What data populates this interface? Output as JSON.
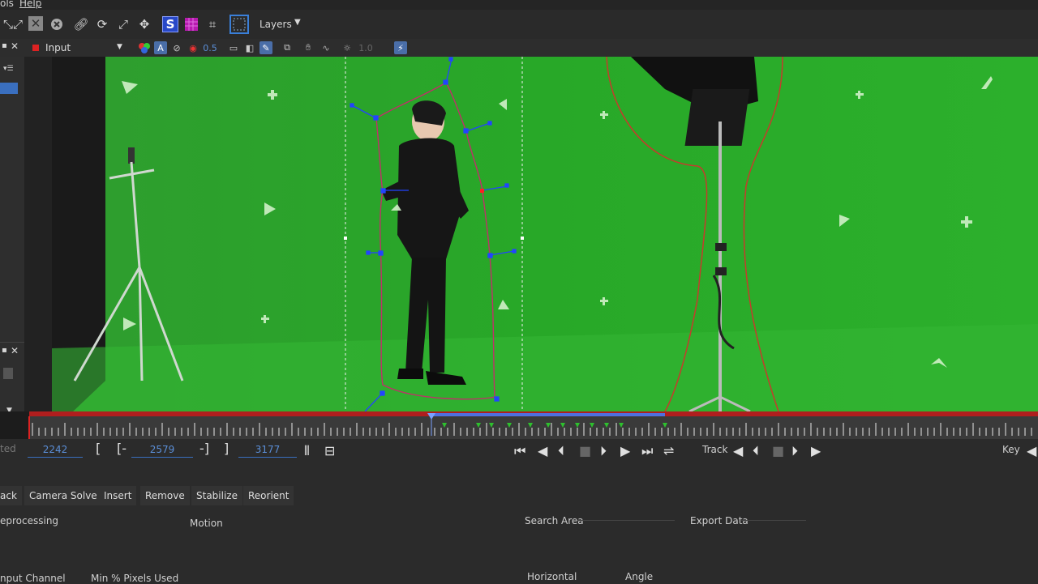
{
  "menu": {
    "tools": "ols",
    "help": "Help"
  },
  "toolbar": {
    "layers_label": "Layers",
    "icons": [
      "arrows-icon",
      "transform-icon",
      "x-box-icon",
      "circle-x-icon",
      "link-icon",
      "rotate-icon",
      "scale-icon",
      "move-icon",
      "s-icon",
      "grid-icon",
      "corner-pin-icon",
      "select-rect-icon"
    ]
  },
  "view": {
    "input_label": "Input",
    "opacity_value": "0.5",
    "exposure_value": "1.0"
  },
  "timeline": {
    "in_frame": "2242",
    "current_frame": "2579",
    "out_frame": "3177",
    "bracket_open": "[",
    "bracket_range_open": "[-",
    "bracket_range_close": "-]",
    "bracket_close": "]",
    "left_cut_label": "ted",
    "track_label": "Track",
    "key_label": "Key"
  },
  "tabs": [
    "ack",
    "Camera Solve",
    "Insert",
    "Remove",
    "Stabilize",
    "Reorient"
  ],
  "params": {
    "preprocessing": "eprocessing",
    "motion": "Motion",
    "search_area": "Search Area",
    "export_data": "Export Data",
    "input_channel": "nput Channel",
    "min_pixels": "Min % Pixels Used",
    "horizontal": "Horizontal",
    "angle": "Angle"
  },
  "colors": {
    "accent": "#3a6fbf",
    "green_screen": "#22a022",
    "timeline_red": "#b01e1e",
    "spline": "#c0306a"
  }
}
